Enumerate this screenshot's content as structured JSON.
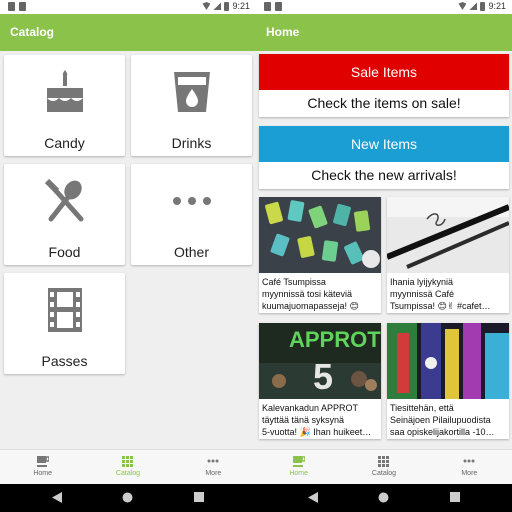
{
  "status": {
    "time": "9:21"
  },
  "catalog": {
    "title": "Catalog",
    "tiles": [
      {
        "label": "Candy",
        "icon": "cake-icon"
      },
      {
        "label": "Drinks",
        "icon": "drink-icon"
      },
      {
        "label": "Food",
        "icon": "utensils-icon"
      },
      {
        "label": "Other",
        "icon": "more-horiz-icon"
      },
      {
        "label": "Passes",
        "icon": "film-icon"
      }
    ]
  },
  "home": {
    "title": "Home",
    "sale": {
      "title": "Sale Items",
      "subtitle": "Check the items on sale!",
      "color": "#e00000"
    },
    "new": {
      "title": "New Items",
      "subtitle": "Check the new arrivals!",
      "color": "#1a9ed4"
    },
    "posts": [
      {
        "text": "Café Tsumpissa\nmyynnissä tosi käteviä\nkuumajuomapasseja! 😊"
      },
      {
        "text": "Ihania lyijykyniä\nmyynnissä Café\nTsumpissa! 😊✌ #cafet…"
      },
      {
        "text": "Kalevankadun APPROT\ntäyttää tänä syksynä\n5-vuotta! 🎉 Ihan huikeet…",
        "image_text": "APPROT 5"
      },
      {
        "text": "Tiesittehän, että\nSeinäjoen Pilailupuodista\nsaa opiskelijakortilla -10…"
      }
    ]
  },
  "nav": {
    "home": "Home",
    "catalog": "Catalog",
    "more": "More"
  },
  "colors": {
    "primary": "#8bc34a",
    "nav_inactive": "#666666"
  }
}
